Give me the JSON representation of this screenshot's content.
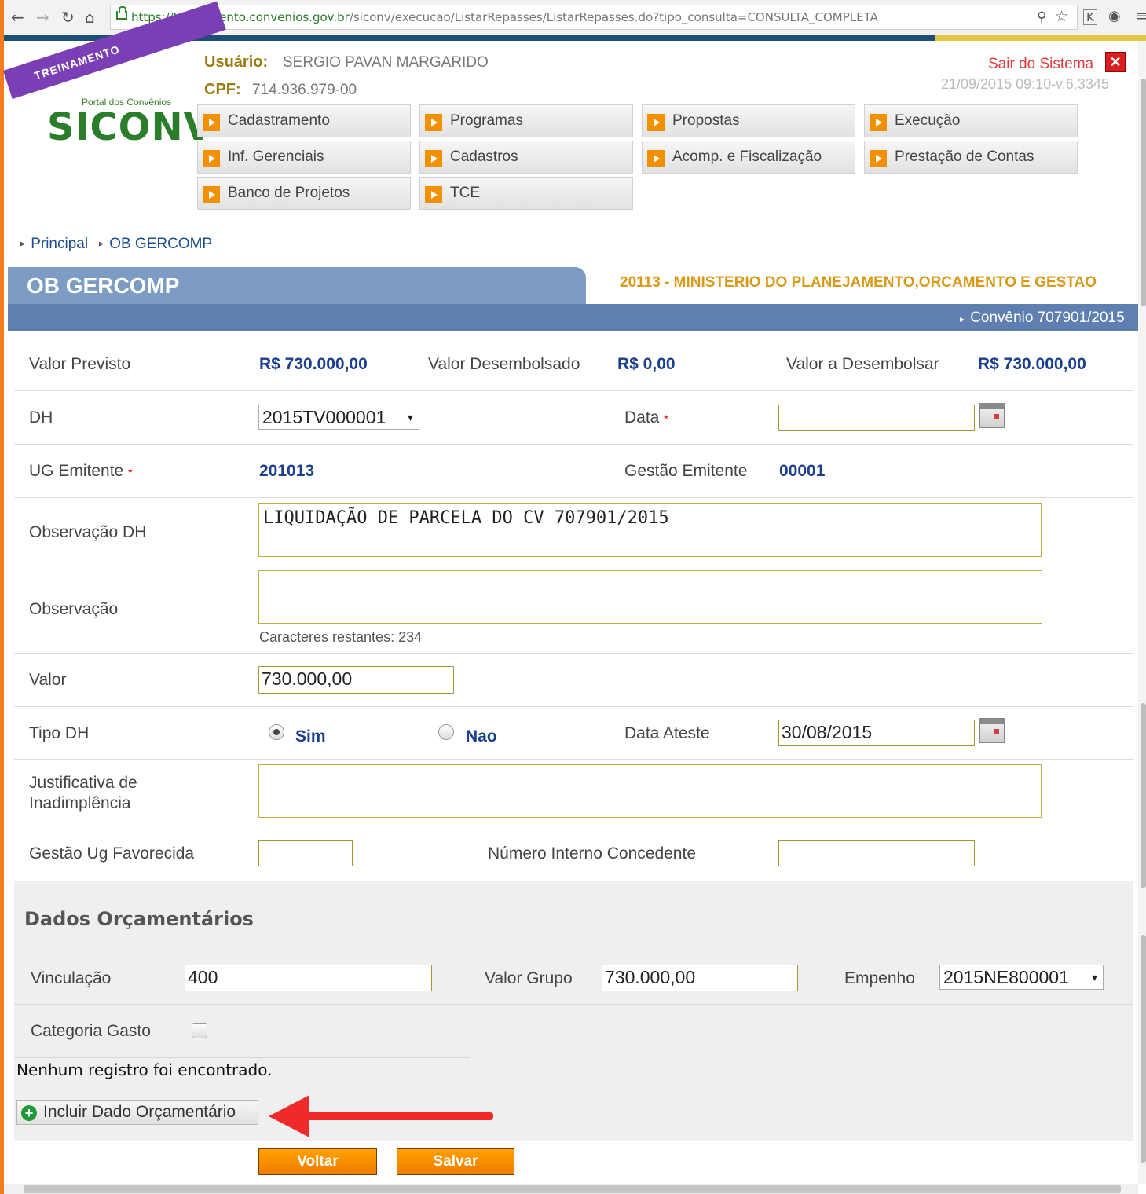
{
  "browser": {
    "url_host": "https://treinamento.convenios.gov.br",
    "url_path": "/siconv/execucao/ListarRepasses/ListarRepasses.do?tipo_consulta=CONSULTA_COMPLETA"
  },
  "logo": {
    "ribbon": "TREINAMENTO",
    "portal": "Portal dos Convênios",
    "name": "SICONV"
  },
  "header": {
    "user_label": "Usuário:",
    "user_value": "SERGIO PAVAN MARGARIDO",
    "cpf_label": "CPF:",
    "cpf_value": "714.936.979-00",
    "logout": "Sair do Sistema",
    "timestamp": "21/09/2015 09:10-v.6.3345"
  },
  "menu": {
    "items": [
      {
        "label": "Cadastramento"
      },
      {
        "label": "Programas"
      },
      {
        "label": "Propostas"
      },
      {
        "label": "Execução"
      },
      {
        "label": "Inf. Gerenciais"
      },
      {
        "label": "Cadastros"
      },
      {
        "label": "Acomp. e Fiscalização"
      },
      {
        "label": "Prestação de Contas"
      },
      {
        "label": "Banco de Projetos"
      },
      {
        "label": "TCE"
      }
    ]
  },
  "breadcrumb": {
    "items": [
      {
        "label": "Principal"
      },
      {
        "label": "OB GERCOMP"
      }
    ]
  },
  "page": {
    "title": "OB GERCOMP",
    "org": "20113 - MINISTERIO DO PLANEJAMENTO,ORCAMENTO E GESTAO",
    "convenio": "Convênio 707901/2015"
  },
  "form": {
    "valor_previsto_label": "Valor Previsto",
    "valor_previsto": "R$ 730.000,00",
    "valor_desembolsado_label": "Valor Desembolsado",
    "valor_desembolsado": "R$ 0,00",
    "valor_a_desembolsar_label": "Valor a Desembolsar",
    "valor_a_desembolsar": "R$ 730.000,00",
    "dh_label": "DH",
    "dh_value": "2015TV000001",
    "data_label": "Data",
    "data_value": "",
    "ug_label": "UG Emitente",
    "ug_value": "201013",
    "gestao_label": "Gestão Emitente",
    "gestao_value": "00001",
    "obs_dh_label": "Observação DH",
    "obs_dh_value": "LIQUIDAÇÃO DE PARCELA DO CV 707901/2015",
    "obs_label": "Observação",
    "obs_value": "",
    "chars_remaining": "Caracteres restantes: 234",
    "valor_label": "Valor",
    "valor_value": "730.000,00",
    "tipo_dh_label": "Tipo DH",
    "tipo_sim": "Sim",
    "tipo_nao": "Nao",
    "data_ateste_label": "Data Ateste",
    "data_ateste_value": "30/08/2015",
    "justificativa_label_1": "Justificativa de",
    "justificativa_label_2": "Inadimplência",
    "justificativa_value": "",
    "gestao_ug_label": "Gestão Ug Favorecida",
    "gestao_ug_value": "",
    "numero_interno_label": "Número Interno Concedente",
    "numero_interno_value": ""
  },
  "dados": {
    "title": "Dados Orçamentários",
    "vinculacao_label": "Vinculação",
    "vinculacao_value": "400",
    "valor_grupo_label": "Valor Grupo",
    "valor_grupo_value": "730.000,00",
    "empenho_label": "Empenho",
    "empenho_value": "2015NE800001",
    "categoria_label": "Categoria Gasto",
    "no_records": "Nenhum registro foi encontrado.",
    "add_button": "Incluir Dado Orçamentário"
  },
  "actions": {
    "voltar": "Voltar",
    "salvar": "Salvar"
  },
  "colors": {
    "accent_orange": "#f07c00",
    "title_blue": "#5f7fb0",
    "value_blue": "#1b3f8c",
    "logo_green": "#2b7d2b",
    "ribbon_purple": "#7b3fb5",
    "annotation_red": "#ee2a2a"
  }
}
